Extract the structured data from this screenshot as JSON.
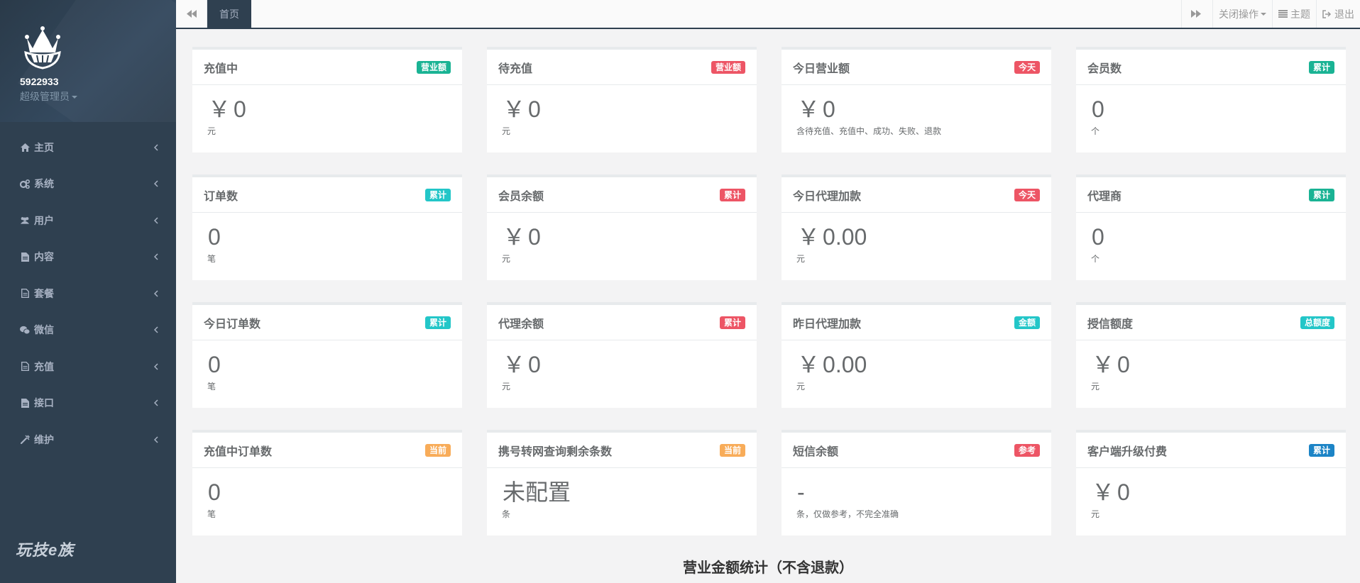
{
  "sidebar": {
    "user": {
      "name": "5922933",
      "role": "超级管理员"
    },
    "items": [
      {
        "label": "主页",
        "icon": "home-icon"
      },
      {
        "label": "系统",
        "icon": "gears-icon"
      },
      {
        "label": "用户",
        "icon": "users-icon"
      },
      {
        "label": "内容",
        "icon": "file-icon"
      },
      {
        "label": "套餐",
        "icon": "file-outline-icon"
      },
      {
        "label": "微信",
        "icon": "wechat-icon"
      },
      {
        "label": "充值",
        "icon": "file-outline-icon"
      },
      {
        "label": "接口",
        "icon": "file-icon"
      },
      {
        "label": "维护",
        "icon": "wrench-icon"
      }
    ],
    "brand": "玩技e族"
  },
  "topbar": {
    "active_tab": "首页",
    "close_ops": "关闭操作",
    "theme": "主题",
    "logout": "退出"
  },
  "colors": {
    "green": "#1ab394",
    "red": "#ed5565",
    "cyan": "#23c6c8",
    "orange": "#f8ac59",
    "blue": "#1c84c6",
    "sidebar": "#2f4050"
  },
  "cards": [
    {
      "title": "充值中",
      "badge": "营业额",
      "badge_color": "#1ab394",
      "value": "0",
      "currency": "￥",
      "unit": "元"
    },
    {
      "title": "待充值",
      "badge": "营业额",
      "badge_color": "#ed5565",
      "value": "0",
      "currency": "￥",
      "unit": "元"
    },
    {
      "title": "今日营业额",
      "badge": "今天",
      "badge_color": "#ed5565",
      "value": "0",
      "currency": "￥",
      "unit": "含待充值、充值中、成功、失败、退款"
    },
    {
      "title": "会员数",
      "badge": "累计",
      "badge_color": "#1ab394",
      "value": "0",
      "currency": "",
      "unit": "个"
    },
    {
      "title": "订单数",
      "badge": "累计",
      "badge_color": "#23c6c8",
      "value": "0",
      "currency": "",
      "unit": "笔"
    },
    {
      "title": "会员余额",
      "badge": "累计",
      "badge_color": "#ed5565",
      "value": "0",
      "currency": "￥",
      "unit": "元"
    },
    {
      "title": "今日代理加款",
      "badge": "今天",
      "badge_color": "#ed5565",
      "value": "0.00",
      "currency": "￥",
      "unit": "元"
    },
    {
      "title": "代理商",
      "badge": "累计",
      "badge_color": "#1ab394",
      "value": "0",
      "currency": "",
      "unit": "个"
    },
    {
      "title": "今日订单数",
      "badge": "累计",
      "badge_color": "#23c6c8",
      "value": "0",
      "currency": "",
      "unit": "笔"
    },
    {
      "title": "代理余额",
      "badge": "累计",
      "badge_color": "#ed5565",
      "value": "0",
      "currency": "￥",
      "unit": "元"
    },
    {
      "title": "昨日代理加款",
      "badge": "金额",
      "badge_color": "#23c6c8",
      "value": "0.00",
      "currency": "￥",
      "unit": "元"
    },
    {
      "title": "授信额度",
      "badge": "总额度",
      "badge_color": "#23c6c8",
      "value": "0",
      "currency": "￥",
      "unit": "元"
    },
    {
      "title": "充值中订单数",
      "badge": "当前",
      "badge_color": "#f8ac59",
      "value": "0",
      "currency": "",
      "unit": "笔"
    },
    {
      "title": "携号转网查询剩余条数",
      "badge": "当前",
      "badge_color": "#f8ac59",
      "value": "未配置",
      "currency": "",
      "unit": "条"
    },
    {
      "title": "短信余额",
      "badge": "参考",
      "badge_color": "#ed5565",
      "value": "-",
      "currency": "",
      "unit": "条，仅做参考，不完全准确"
    },
    {
      "title": "客户端升级付费",
      "badge": "累计",
      "badge_color": "#1c84c6",
      "value": "0",
      "currency": "￥",
      "unit": "元"
    }
  ],
  "section_title": "营业金额统计（不含退款）"
}
